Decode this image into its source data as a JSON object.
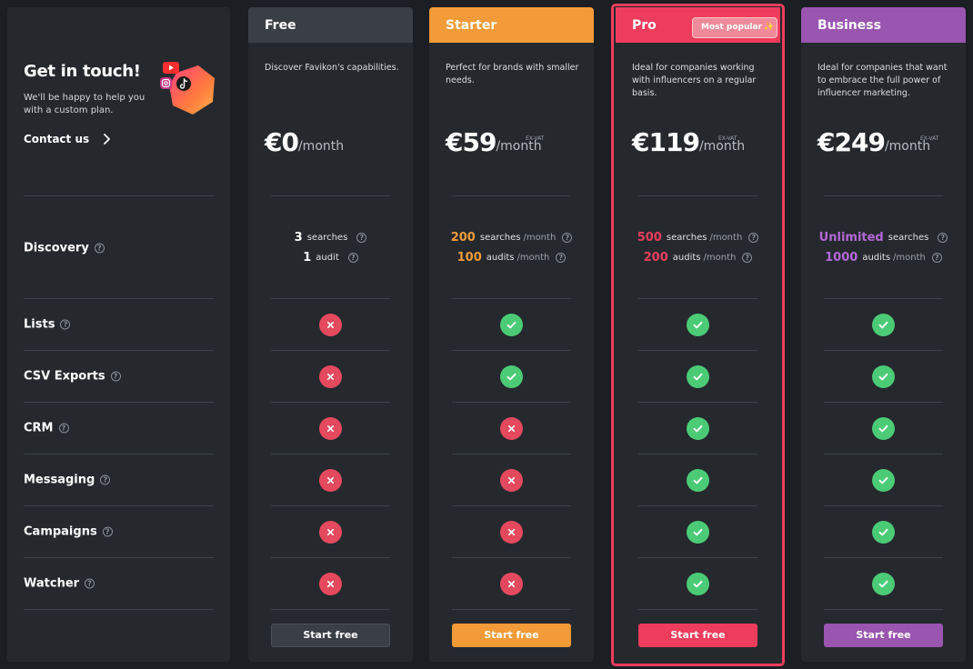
{
  "colors": {
    "free": "#3a3f45",
    "starter": "#f29b38",
    "pro": "#ee3d5c",
    "business": "#9a55b0",
    "check": "#4ccb76",
    "cross": "#e5495e"
  },
  "contact_panel": {
    "title": "Get in touch!",
    "subtitle": "We'll be happy to help you with a custom plan.",
    "cta": "Contact us",
    "cta_icon": "chevron-right-icon",
    "logo_icons": [
      "youtube-icon",
      "instagram-icon",
      "tiktok-icon"
    ]
  },
  "features": [
    {
      "key": "discovery",
      "label": "Discovery"
    },
    {
      "key": "lists",
      "label": "Lists"
    },
    {
      "key": "csv_exports",
      "label": "CSV Exports"
    },
    {
      "key": "crm",
      "label": "CRM"
    },
    {
      "key": "messaging",
      "label": "Messaging"
    },
    {
      "key": "campaigns",
      "label": "Campaigns"
    },
    {
      "key": "watcher",
      "label": "Watcher"
    }
  ],
  "help_icon": "question-circle-icon",
  "plans": [
    {
      "key": "free",
      "name": "Free",
      "description": "Discover Favikon's capabilities.",
      "price": "€0",
      "period": "/month",
      "ex_vat": "",
      "searches_value": "3",
      "searches_label": "searches",
      "searches_period": "",
      "audits_value": "1",
      "audits_label": "audit",
      "audits_period": "",
      "features": {
        "lists": false,
        "csv_exports": false,
        "crm": false,
        "messaging": false,
        "campaigns": false,
        "watcher": false
      },
      "button": "Start free"
    },
    {
      "key": "starter",
      "name": "Starter",
      "description": "Perfect for brands with smaller needs.",
      "price": "€59",
      "period": "/month",
      "ex_vat": "EX-VAT",
      "searches_value": "200",
      "searches_label": "searches",
      "searches_period": "/month",
      "audits_value": "100",
      "audits_label": "audits",
      "audits_period": "/month",
      "features": {
        "lists": true,
        "csv_exports": true,
        "crm": false,
        "messaging": false,
        "campaigns": false,
        "watcher": false
      },
      "button": "Start free"
    },
    {
      "key": "pro",
      "name": "Pro",
      "badge": "Most popular",
      "badge_icon": "sparkle-icon",
      "description": "Ideal for companies working with influencers on a regular basis.",
      "price": "€119",
      "period": "/month",
      "ex_vat": "EX-VAT",
      "searches_value": "500",
      "searches_label": "searches",
      "searches_period": "/month",
      "audits_value": "200",
      "audits_label": "audits",
      "audits_period": "/month",
      "features": {
        "lists": true,
        "csv_exports": true,
        "crm": true,
        "messaging": true,
        "campaigns": true,
        "watcher": true
      },
      "button": "Start free"
    },
    {
      "key": "business",
      "name": "Business",
      "description": "Ideal for companies that want to embrace the full power of influencer marketing.",
      "price": "€249",
      "period": "/month",
      "ex_vat": "EX-VAT",
      "searches_value": "Unlimited",
      "searches_label": "searches",
      "searches_period": "",
      "audits_value": "1000",
      "audits_label": "audits",
      "audits_period": "/month",
      "features": {
        "lists": true,
        "csv_exports": true,
        "crm": true,
        "messaging": true,
        "campaigns": true,
        "watcher": true
      },
      "button": "Start free"
    }
  ]
}
